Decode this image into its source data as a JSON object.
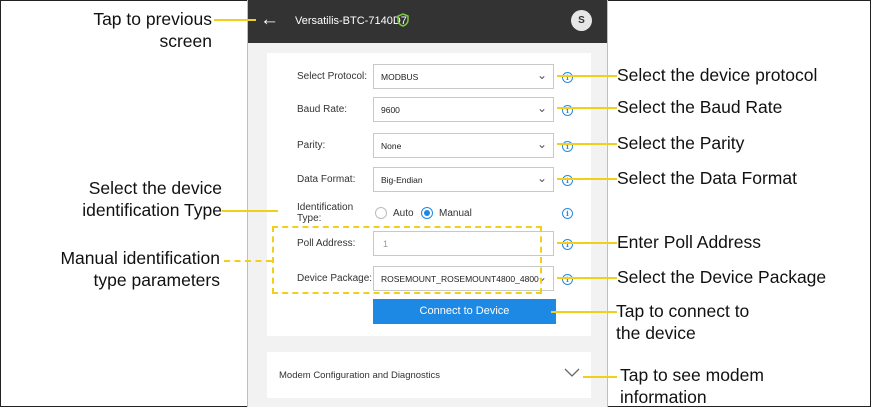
{
  "app": {
    "device_name": "Versatilis-BTC-7140D7",
    "avatar_initial": "S",
    "back_icon": "←"
  },
  "form": {
    "protocol": {
      "label": "Select Protocol:",
      "value": "MODBUS"
    },
    "baud_rate": {
      "label": "Baud Rate:",
      "value": "9600"
    },
    "parity": {
      "label": "Parity:",
      "value": "None"
    },
    "data_format": {
      "label": "Data Format:",
      "value": "Big-Endian"
    },
    "identification_type": {
      "label": "Identification Type:",
      "options": [
        "Auto",
        "Manual"
      ],
      "selected": "Manual"
    },
    "poll_address": {
      "label": "Poll Address:",
      "value": "1"
    },
    "device_package": {
      "label": "Device Package:",
      "value": "ROSEMOUNT_ROSEMOUNT4800_4800"
    },
    "connect_button": "Connect to Device"
  },
  "modem": {
    "label": "Modem Configuration and Diagnostics"
  },
  "annotations": {
    "back": "Tap to previous\nscreen",
    "ident_type": "Select the device\nidentification Type",
    "manual_params": "Manual identification\ntype parameters",
    "protocol": "Select the device protocol",
    "baud_rate": "Select the Baud Rate",
    "parity": "Select the Parity",
    "data_format": "Select the Data Format",
    "poll_address": "Enter Poll Address",
    "device_package": "Select the Device Package",
    "connect": "Tap to connect to\nthe device",
    "modem": "Tap to see modem\ninformation"
  },
  "colors": {
    "topbar": "#333333",
    "accent": "#1e88e5",
    "callout": "#f2cf1d",
    "shield": "#7ac943"
  }
}
